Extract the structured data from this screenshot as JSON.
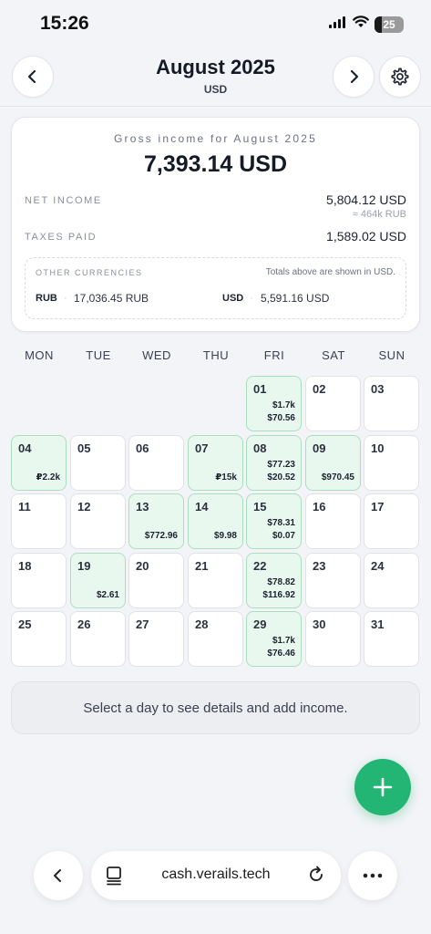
{
  "status": {
    "time": "15:26",
    "battery": "25",
    "battery_level": 0.25
  },
  "header": {
    "title": "August 2025",
    "subtitle": "USD"
  },
  "summary": {
    "gross_label": "Gross income for August 2025",
    "gross_value": "7,393.14 USD",
    "net_label": "NET INCOME",
    "net_value": "5,804.12 USD",
    "net_approx": "≈ 464k RUB",
    "taxes_label": "TAXES PAID",
    "taxes_value": "1,589.02 USD",
    "other_label": "OTHER CURRENCIES",
    "other_note": "Totals above are shown in USD.",
    "currencies": [
      {
        "code": "RUB",
        "value": "17,036.45 RUB"
      },
      {
        "code": "USD",
        "value": "5,591.16 USD"
      }
    ]
  },
  "calendar": {
    "weekdays": [
      "MON",
      "TUE",
      "WED",
      "THU",
      "FRI",
      "SAT",
      "SUN"
    ],
    "days": [
      {
        "num": "01",
        "amounts": [
          "$1.7k",
          "$70.56"
        ]
      },
      {
        "num": "02",
        "amounts": []
      },
      {
        "num": "03",
        "amounts": []
      },
      {
        "num": "04",
        "amounts": [
          "₽2.2k"
        ]
      },
      {
        "num": "05",
        "amounts": []
      },
      {
        "num": "06",
        "amounts": []
      },
      {
        "num": "07",
        "amounts": [
          "₽15k"
        ]
      },
      {
        "num": "08",
        "amounts": [
          "$77.23",
          "$20.52"
        ]
      },
      {
        "num": "09",
        "amounts": [
          "$970.45"
        ]
      },
      {
        "num": "10",
        "amounts": []
      },
      {
        "num": "11",
        "amounts": []
      },
      {
        "num": "12",
        "amounts": []
      },
      {
        "num": "13",
        "amounts": [
          "$772.96"
        ]
      },
      {
        "num": "14",
        "amounts": [
          "$9.98"
        ]
      },
      {
        "num": "15",
        "amounts": [
          "$78.31",
          "$0.07"
        ]
      },
      {
        "num": "16",
        "amounts": []
      },
      {
        "num": "17",
        "amounts": []
      },
      {
        "num": "18",
        "amounts": []
      },
      {
        "num": "19",
        "amounts": [
          "$2.61"
        ]
      },
      {
        "num": "20",
        "amounts": []
      },
      {
        "num": "21",
        "amounts": []
      },
      {
        "num": "22",
        "amounts": [
          "$78.82",
          "$116.92"
        ]
      },
      {
        "num": "23",
        "amounts": []
      },
      {
        "num": "24",
        "amounts": []
      },
      {
        "num": "25",
        "amounts": []
      },
      {
        "num": "26",
        "amounts": []
      },
      {
        "num": "27",
        "amounts": []
      },
      {
        "num": "28",
        "amounts": []
      },
      {
        "num": "29",
        "amounts": [
          "$1.7k",
          "$76.46"
        ]
      },
      {
        "num": "30",
        "amounts": []
      },
      {
        "num": "31",
        "amounts": []
      }
    ]
  },
  "hint": "Select a day to see details and add income.",
  "browser": {
    "url": "cash.verails.tech"
  },
  "colors": {
    "accent": "#22b573",
    "income_day_bg": "#e9f8ef",
    "income_day_border": "#a9dfbf"
  },
  "icons": [
    "chevron-left-icon",
    "chevron-right-icon",
    "gear-icon",
    "plus-icon",
    "tabs-icon",
    "reload-icon",
    "more-icon",
    "signal-icon",
    "wifi-icon",
    "battery-icon"
  ]
}
